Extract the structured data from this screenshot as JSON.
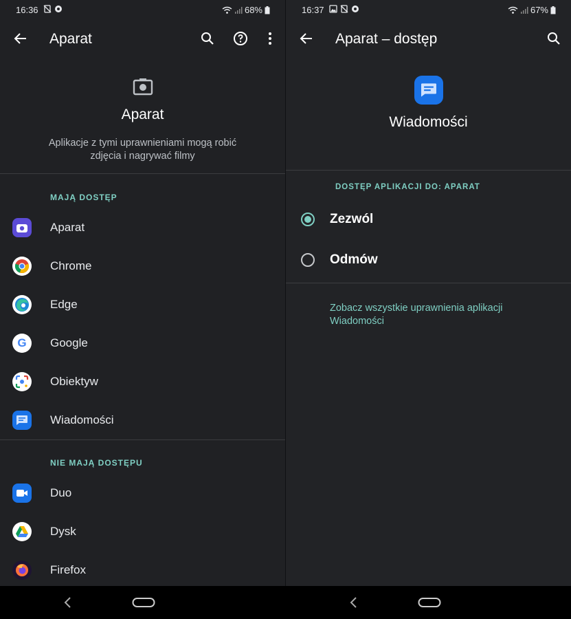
{
  "left": {
    "status": {
      "time": "16:36",
      "battery": "68%"
    },
    "toolbar": {
      "title": "Aparat"
    },
    "header": {
      "title": "Aparat",
      "description_line1": "Aplikacje z tymi uprawnieniami mogą robić",
      "description_line2": "zdjęcia i nagrywać filmy"
    },
    "allowed": {
      "heading": "MAJĄ DOSTĘP",
      "apps": [
        {
          "label": "Aparat",
          "icon": "camera-app-icon"
        },
        {
          "label": "Chrome",
          "icon": "chrome-icon"
        },
        {
          "label": "Edge",
          "icon": "edge-icon"
        },
        {
          "label": "Google",
          "icon": "google-icon"
        },
        {
          "label": "Obiektyw",
          "icon": "lens-icon"
        },
        {
          "label": "Wiadomości",
          "icon": "messages-icon"
        }
      ]
    },
    "denied": {
      "heading": "NIE MAJĄ DOSTĘPU",
      "apps": [
        {
          "label": "Duo",
          "icon": "duo-icon"
        },
        {
          "label": "Dysk",
          "icon": "drive-icon"
        },
        {
          "label": "Firefox",
          "icon": "firefox-icon"
        }
      ]
    }
  },
  "right": {
    "status": {
      "time": "16:37",
      "battery": "67%"
    },
    "toolbar": {
      "title": "Aparat – dostęp"
    },
    "header": {
      "app_name": "Wiadomości"
    },
    "section": "DOSTĘP APLIKACJI DO: APARAT",
    "options": {
      "allow": "Zezwól",
      "deny": "Odmów",
      "selected": "allow"
    },
    "link_line1": "Zobacz wszystkie uprawnienia aplikacji",
    "link_line2": "Wiadomości"
  },
  "colors": {
    "accent": "#7fcfc3",
    "background": "#202124"
  }
}
